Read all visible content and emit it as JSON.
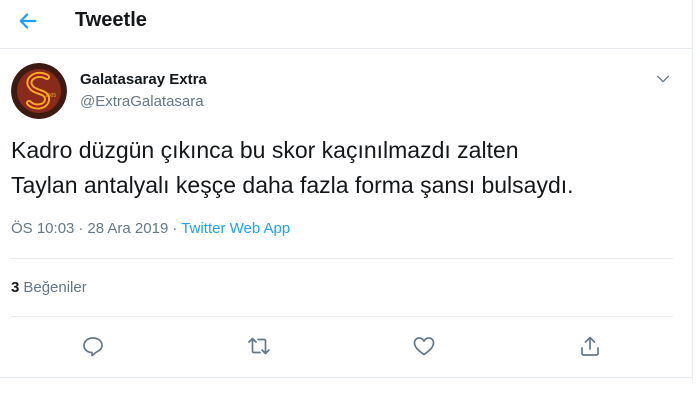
{
  "header": {
    "title": "Tweetle",
    "back_icon": "arrow-left-icon"
  },
  "colors": {
    "accent": "#1da1f2",
    "muted": "#657786",
    "text": "#14171a",
    "border": "#e6ecf0",
    "logo_red": "#a51c30",
    "logo_gold": "#f6b21b"
  },
  "tweet": {
    "author_name": "Galatasaray Extra",
    "author_handle": "@ExtraGalatasara",
    "text_line1": "Kadro düzgün çıkınca bu skor kaçınılmazdı zalten",
    "text_line2": "Taylan antalyalı keşçe daha fazla forma şansı bulsaydı.",
    "time": "ÖS 10:03",
    "separator": "·",
    "date": "28 Ara 2019",
    "source": "Twitter Web App",
    "likes_count": "3",
    "likes_label": "Beğeniler"
  },
  "avatar": {
    "logo_year": "1905"
  },
  "actions": [
    "reply-icon",
    "retweet-icon",
    "like-icon",
    "share-icon"
  ]
}
